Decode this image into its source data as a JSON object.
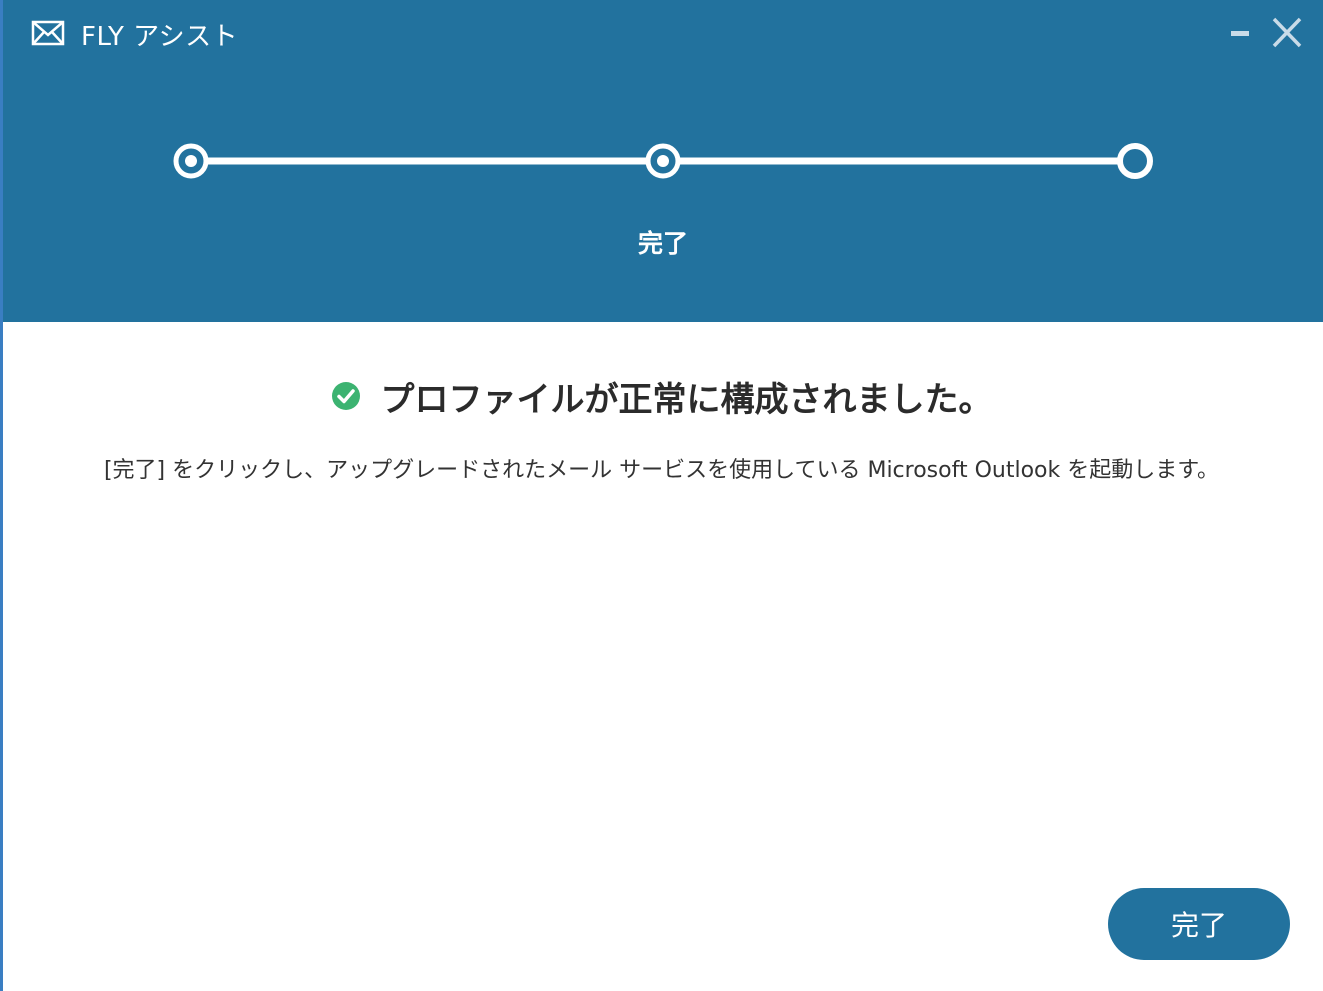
{
  "window": {
    "title": "FLY アシスト",
    "icon": "mail-icon",
    "controls": [
      "minimize-icon",
      "close-icon"
    ]
  },
  "stepper": {
    "current_step_label": "完了",
    "step_count": 3,
    "active_step": 3
  },
  "content": {
    "heading": "プロファイルが正常に構成されました。",
    "heading_icon": "check-circle-icon",
    "description": "[完了] をクリックし、アップグレードされたメール サービスを使用している Microsoft Outlook を起動します。"
  },
  "footer": {
    "finish_label": "完了"
  },
  "colors": {
    "header_bg": "#22729e",
    "success": "#3cb371",
    "button_bg": "#22729e"
  }
}
